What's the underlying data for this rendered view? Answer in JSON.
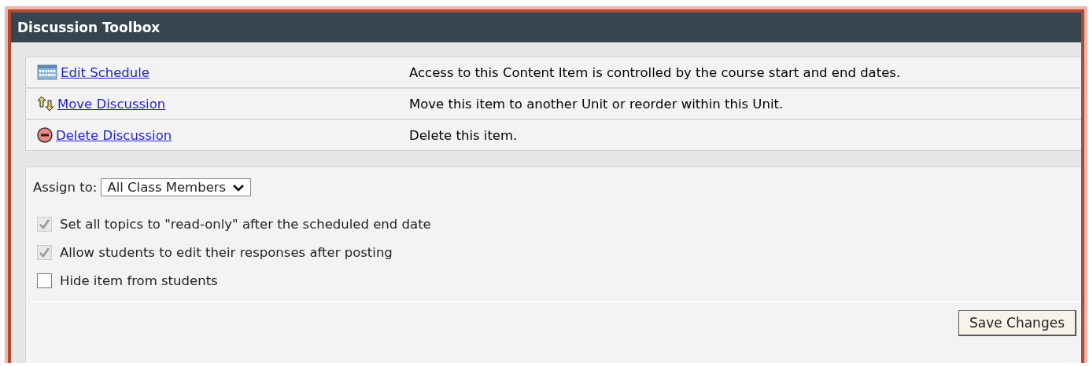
{
  "window": {
    "title": "Discussion Toolbox"
  },
  "actions": [
    {
      "kind": "schedule",
      "label": "Edit Schedule",
      "description": "Access to this Content Item is controlled by the course start and end dates."
    },
    {
      "kind": "move",
      "label": "Move Discussion",
      "description": "Move this item to another Unit or reorder within this Unit."
    },
    {
      "kind": "delete",
      "label": "Delete Discussion",
      "description": "Delete this item."
    }
  ],
  "assign": {
    "label": "Assign to:",
    "value": "All Class Members"
  },
  "options": [
    {
      "label": "Set all topics to \"read-only\" after the scheduled end date",
      "checked": true,
      "disabled": true
    },
    {
      "label": "Allow students to edit their responses after posting",
      "checked": true,
      "disabled": true
    },
    {
      "label": "Hide item from students",
      "checked": false,
      "disabled": false
    }
  ],
  "buttons": [
    "Save Changes"
  ]
}
